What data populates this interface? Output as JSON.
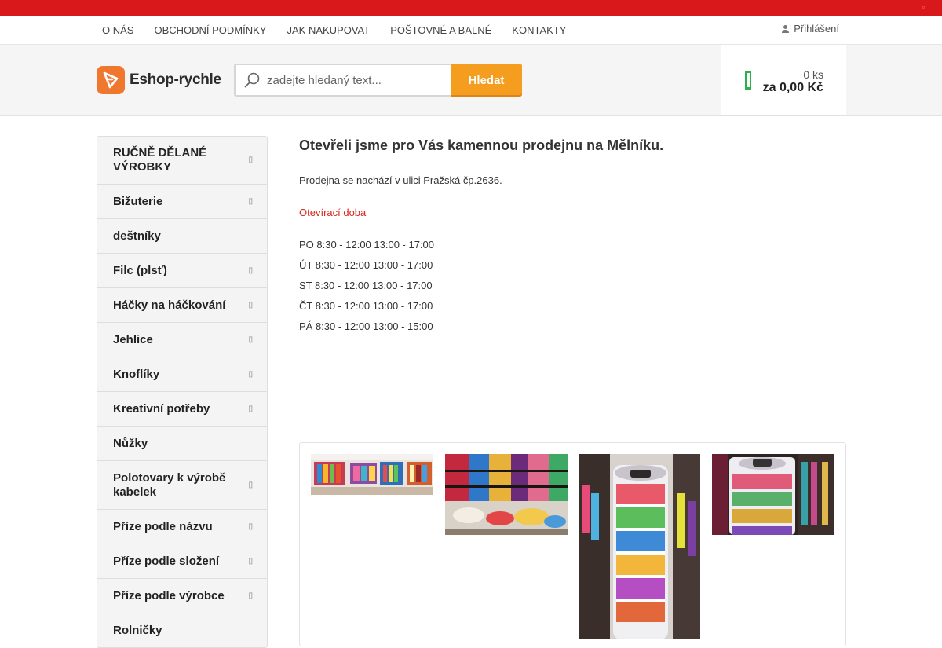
{
  "nav": {
    "items": [
      "O NÁS",
      "OBCHODNÍ PODMÍNKY",
      "JAK NAKUPOVAT",
      "POŠTOVNÉ A BALNÉ",
      "KONTAKTY"
    ],
    "login": "Přihlášení"
  },
  "logo": {
    "text": "Eshop-rychle"
  },
  "search": {
    "placeholder": "zadejte hledaný text...",
    "button": "Hledat"
  },
  "cart": {
    "quantity": "0 ks",
    "price": "za 0,00 Kč"
  },
  "sidebar": {
    "items": [
      {
        "label": "RUČNĚ DĚLANÉ VÝROBKY",
        "has_children": true
      },
      {
        "label": "Bižuterie",
        "has_children": true
      },
      {
        "label": "deštníky",
        "has_children": false
      },
      {
        "label": "Filc (plsť)",
        "has_children": true
      },
      {
        "label": "Háčky na háčkování",
        "has_children": true
      },
      {
        "label": "Jehlice",
        "has_children": true
      },
      {
        "label": "Knoflíky",
        "has_children": true
      },
      {
        "label": "Kreativní potřeby",
        "has_children": true
      },
      {
        "label": "Nůžky",
        "has_children": false
      },
      {
        "label": "Polotovary k výrobě kabelek",
        "has_children": true
      },
      {
        "label": "Příze podle názvu",
        "has_children": true
      },
      {
        "label": "Příze podle složení",
        "has_children": true
      },
      {
        "label": "Příze podle výrobce",
        "has_children": true
      },
      {
        "label": "Rolničky",
        "has_children": false
      }
    ]
  },
  "main": {
    "title": "Otevřeli jsme pro Vás kamennou prodejnu na Mělníku.",
    "intro": "Prodejna se nachází v ulici Pražská čp.2636.",
    "hours_label": "Otevírací doba",
    "hours": [
      "PO 8:30 - 12:00 13:00 - 17:00",
      "ÚT 8:30 - 12:00 13:00 - 17:00",
      "ST 8:30 - 12:00 13:00 - 17:00",
      "ČT 8:30 - 12:00 13:00 - 17:00",
      "PÁ 8:30 - 12:00 13:00 - 15:00"
    ]
  },
  "colors": {
    "topbar": "#d8181b",
    "accent": "#f59d1f",
    "logo": "#f0772e",
    "cart_icon": "#2ab24a",
    "link": "#d8291e"
  }
}
